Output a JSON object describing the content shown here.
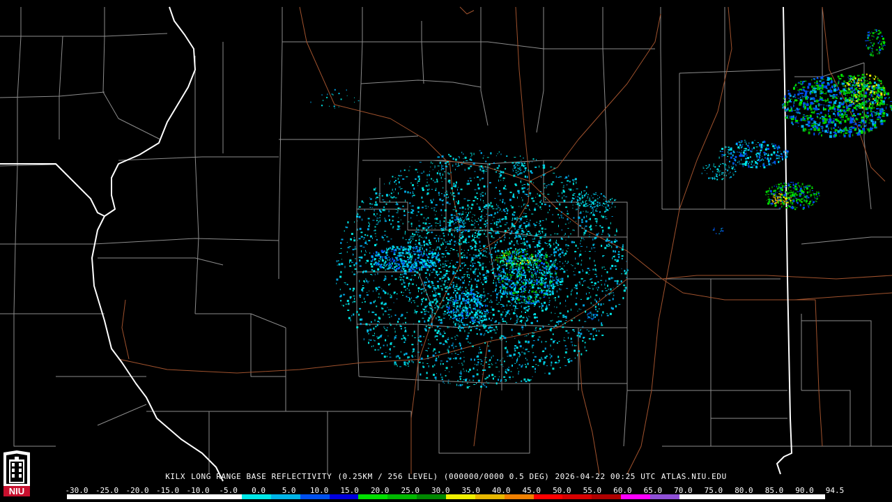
{
  "product": {
    "station": "KILX",
    "title": "LONG RANGE BASE REFLECTIVITY",
    "resolution": "(0.25KM / 256 LEVEL)",
    "volume": "(000000/0000 0.5 DEG)",
    "timestamp": "2026-04-22 00:25 UTC",
    "source": "ATLAS.NIU.EDU"
  },
  "logo": {
    "text": "NIU",
    "icon": "university-tower-icon",
    "color": "#c8102e"
  },
  "colorbar": {
    "ticks": [
      "-30.0",
      "-25.0",
      "-20.0",
      "-15.0",
      "-10.0",
      "-5.0",
      "0.0",
      "5.0",
      "10.0",
      "15.0",
      "20.0",
      "25.0",
      "30.0",
      "35.0",
      "40.0",
      "45.0",
      "50.0",
      "55.0",
      "60.0",
      "65.0",
      "70.0",
      "75.0",
      "80.0",
      "85.0",
      "90.0",
      "94.5"
    ],
    "colors": [
      "#ffffff",
      "#ffffff",
      "#ffffff",
      "#ffffff",
      "#ffffff",
      "#ffffff",
      "#00e8e8",
      "#00b4e8",
      "#0050f0",
      "#0000e0",
      "#00e000",
      "#00b800",
      "#008800",
      "#f0f000",
      "#e8b800",
      "#f08000",
      "#ff0000",
      "#d80000",
      "#b00000",
      "#ff00ff",
      "#9050d8",
      "#ffffff",
      "#ffffff",
      "#ffffff",
      "#ffffff",
      "#ffffff"
    ]
  },
  "map_colors": {
    "background": "#000000",
    "county_lines": "#8c8c8c",
    "state_lines": "#ffffff",
    "roads": "#a0522d"
  }
}
